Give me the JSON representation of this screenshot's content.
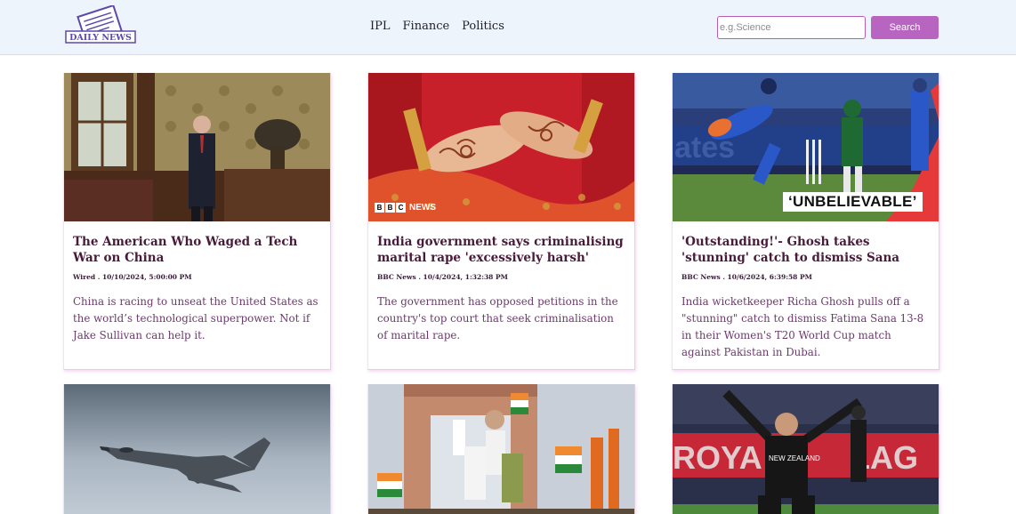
{
  "header": {
    "logo_text": "DAILY NEWS",
    "nav": [
      "IPL",
      "Finance",
      "Politics"
    ],
    "search": {
      "placeholder": "e.g.Science",
      "button_label": "Search"
    },
    "colors": {
      "header_bg": "#eef4fb",
      "accent": "#b765c0"
    }
  },
  "articles": [
    {
      "title": "The American Who Waged a Tech War on China",
      "meta": "Wired . 10/10/2024, 5:00:00 PM",
      "description": "China is racing to unseat the United States as the world’s technological superpower. Not if Jake Sullivan can help it.",
      "image": "portrait-in-ornate-office"
    },
    {
      "title": "India government says criminalising marital rape 'excessively harsh'",
      "meta": "BBC News . 10/4/2024, 1:32:38 PM",
      "description": "The government has opposed petitions in the country's top court that seek criminalisation of marital rape.",
      "image": "henna-hands-red-sari",
      "badge": [
        "B",
        "B",
        "C",
        "NEWS"
      ]
    },
    {
      "title": "'Outstanding!'- Ghosh takes 'stunning' catch to dismiss Sana",
      "meta": "BBC News . 10/6/2024, 6:39:58 PM",
      "description": "India wicketkeeper Richa Ghosh pulls off a \"stunning\" catch to dismiss Fatima Sana 13-8 in their Women's T20 World Cup match against Pakistan in Dubai.",
      "image": "cricket-wicketkeeper-catch",
      "overlay": "‘UNBELIEVABLE’"
    },
    {
      "image": "fighter-jet-in-sky"
    },
    {
      "image": "india-gate-flags-crowd"
    },
    {
      "image": "cricketer-celebrating"
    }
  ]
}
